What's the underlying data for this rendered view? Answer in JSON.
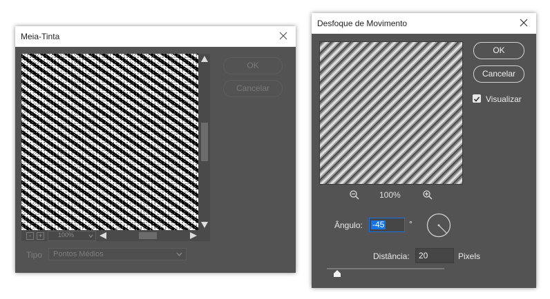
{
  "left_dialog": {
    "title": "Meia-Tinta",
    "ok_label": "OK",
    "cancel_label": "Cancelar",
    "zoom_level": "100%",
    "type_label": "Tipo",
    "type_value": "Pontos Médios",
    "zoom_out_glyph": "-",
    "zoom_in_glyph": "+"
  },
  "right_dialog": {
    "title": "Desfoque de Movimento",
    "ok_label": "OK",
    "cancel_label": "Cancelar",
    "preview_label": "Visualizar",
    "preview_checked": true,
    "zoom_level": "100%",
    "angle_label": "Ângulo:",
    "angle_value": "-45",
    "angle_unit": "°",
    "distance_label": "Distância:",
    "distance_value": "20",
    "distance_unit": "Pixels",
    "distance_slider_fraction": 0.09
  },
  "colors": {
    "dialog_bg": "#535353",
    "titlebar_bg": "#ffffff",
    "accent": "#1473e6"
  }
}
